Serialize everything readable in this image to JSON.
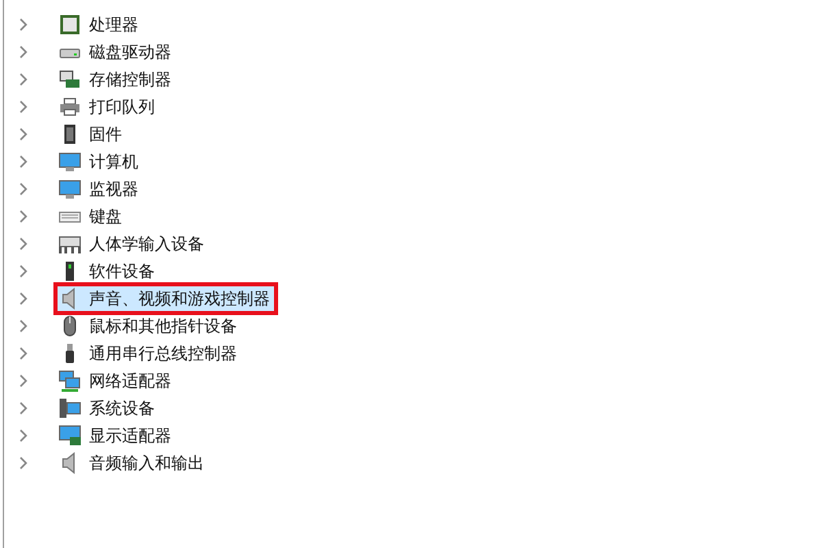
{
  "tree": {
    "items": [
      {
        "label": "处理器",
        "kind": "cpu",
        "selected": false,
        "expanded": false
      },
      {
        "label": "磁盘驱动器",
        "kind": "disk",
        "selected": false,
        "expanded": false
      },
      {
        "label": "存储控制器",
        "kind": "storage",
        "selected": false,
        "expanded": false
      },
      {
        "label": "打印队列",
        "kind": "printer",
        "selected": false,
        "expanded": false
      },
      {
        "label": "固件",
        "kind": "chip",
        "selected": false,
        "expanded": false
      },
      {
        "label": "计算机",
        "kind": "monitor",
        "selected": false,
        "expanded": false
      },
      {
        "label": "监视器",
        "kind": "monitor",
        "selected": false,
        "expanded": false
      },
      {
        "label": "键盘",
        "kind": "keyboard",
        "selected": false,
        "expanded": false
      },
      {
        "label": "人体学输入设备",
        "kind": "hid",
        "selected": false,
        "expanded": false
      },
      {
        "label": "软件设备",
        "kind": "device",
        "selected": false,
        "expanded": false
      },
      {
        "label": "声音、视频和游戏控制器",
        "kind": "speaker",
        "selected": true,
        "expanded": false,
        "annotated": true
      },
      {
        "label": "鼠标和其他指针设备",
        "kind": "mouse",
        "selected": false,
        "expanded": false
      },
      {
        "label": "通用串行总线控制器",
        "kind": "usb",
        "selected": false,
        "expanded": false
      },
      {
        "label": "网络适配器",
        "kind": "network",
        "selected": false,
        "expanded": false
      },
      {
        "label": "系统设备",
        "kind": "system",
        "selected": false,
        "expanded": false
      },
      {
        "label": "显示适配器",
        "kind": "display",
        "selected": false,
        "expanded": false
      },
      {
        "label": "音频输入和输出",
        "kind": "speaker",
        "selected": false,
        "expanded": false
      }
    ]
  }
}
